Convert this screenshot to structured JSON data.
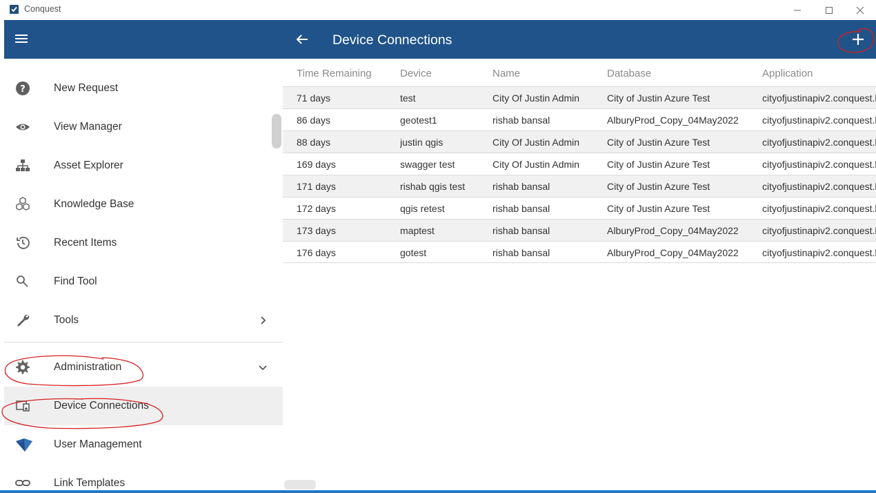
{
  "window": {
    "title": "Conquest"
  },
  "drawer": {
    "items": [
      {
        "label": "New Request",
        "icon": "help-circle-icon"
      },
      {
        "label": "View Manager",
        "icon": "eye-icon"
      },
      {
        "label": "Asset Explorer",
        "icon": "hierarchy-icon"
      },
      {
        "label": "Knowledge Base",
        "icon": "cubes-icon"
      },
      {
        "label": "Recent Items",
        "icon": "history-icon"
      },
      {
        "label": "Find Tool",
        "icon": "search-icon"
      },
      {
        "label": "Tools",
        "icon": "wrench-icon"
      }
    ],
    "admin": {
      "label": "Administration",
      "icon": "gear-icon"
    },
    "admin_items": [
      {
        "label": "Device Connections",
        "icon": "devices-icon"
      },
      {
        "label": "User Management",
        "icon": "diamond-icon"
      },
      {
        "label": "Link Templates",
        "icon": "link-icon"
      }
    ]
  },
  "main": {
    "title": "Device Connections",
    "columns": [
      "Time Remaining",
      "Device",
      "Name",
      "Database",
      "Application"
    ],
    "rows": [
      [
        "71 days",
        "test",
        "City Of Justin Admin",
        "City of Justin Azure Test",
        "cityofjustinapiv2.conquest.l"
      ],
      [
        "86 days",
        "geotest1",
        "rishab bansal",
        "AlburyProd_Copy_04May2022",
        "cityofjustinapiv2.conquest.l"
      ],
      [
        "88 days",
        "justin qgis",
        "City Of Justin Admin",
        "City of Justin Azure Test",
        "cityofjustinapiv2.conquest.l"
      ],
      [
        "169 days",
        "swagger test",
        "City Of Justin Admin",
        "City of Justin Azure Test",
        "cityofjustinapiv2.conquest.l"
      ],
      [
        "171 days",
        "rishab qgis test",
        "rishab bansal",
        "City of Justin Azure Test",
        "cityofjustinapiv2.conquest.l"
      ],
      [
        "172 days",
        "qgis retest",
        "rishab bansal",
        "City of Justin Azure Test",
        "cityofjustinapiv2.conquest.l"
      ],
      [
        "173 days",
        "maptest",
        "rishab bansal",
        "AlburyProd_Copy_04May2022",
        "cityofjustinapiv2.conquest.l"
      ],
      [
        "176 days",
        "gotest",
        "rishab bansal",
        "AlburyProd_Copy_04May2022",
        "cityofjustinapiv2.conquest.l"
      ]
    ]
  },
  "colors": {
    "header": "#1f5389",
    "annotation": "#d61f1f",
    "selected_row": "#efefef"
  }
}
